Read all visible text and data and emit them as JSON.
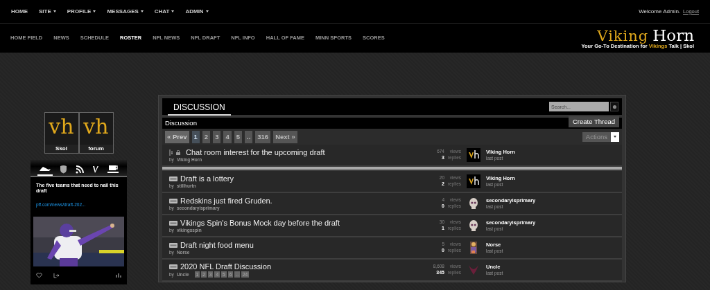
{
  "top_nav": [
    {
      "label": "HOME",
      "has_menu": false
    },
    {
      "label": "SITE",
      "has_menu": true
    },
    {
      "label": "PROFILE",
      "has_menu": true
    },
    {
      "label": "MESSAGES",
      "has_menu": true
    },
    {
      "label": "CHAT",
      "has_menu": true
    },
    {
      "label": "ADMIN",
      "has_menu": true
    }
  ],
  "welcome": "Welcome Admin.",
  "logout": "Logout",
  "main_nav": [
    {
      "label": "HOME FIELD",
      "selected": false
    },
    {
      "label": "NEWS",
      "selected": false
    },
    {
      "label": "SCHEDULE",
      "selected": false
    },
    {
      "label": "ROSTER",
      "selected": true
    },
    {
      "label": "NFL NEWS",
      "selected": false
    },
    {
      "label": "NFL DRAFT",
      "selected": false
    },
    {
      "label": "NFL INFO",
      "selected": false
    },
    {
      "label": "HALL OF FAME",
      "selected": false
    },
    {
      "label": "MINN SPORTS",
      "selected": false
    },
    {
      "label": "SCORES",
      "selected": false
    }
  ],
  "site_logo": {
    "word1": "Viking",
    "word2": "Horn",
    "tagline_before": "Your Go-To Destination for ",
    "tagline_highlight": "Vikings",
    "tagline_after": " Talk | Skol"
  },
  "sidebar": {
    "logo": {
      "tiles": [
        {
          "letters": "vh",
          "caption": "Skol"
        },
        {
          "letters": "vh",
          "caption": "forum"
        }
      ]
    },
    "widget_tabs": [
      {
        "kind": "ship",
        "selected": true
      },
      {
        "kind": "shield",
        "selected": false
      },
      {
        "kind": "rss",
        "selected": false
      },
      {
        "kind": "v",
        "selected": false
      },
      {
        "kind": "cup",
        "selected": false
      }
    ],
    "tweet": {
      "text": "The five teams that need to nail this draft",
      "link": "pff.com/news/draft-202..."
    }
  },
  "forum": {
    "heading": "DISCUSSION",
    "search": {
      "placeholder": "Search..."
    },
    "section_title": "Discussion",
    "create_button": "Create Thread",
    "actions_button": "Actions",
    "pagination": [
      {
        "label": "« Prev",
        "selected": false,
        "disabled": true
      },
      {
        "label": "1",
        "selected": true,
        "disabled": false
      },
      {
        "label": "2",
        "selected": false,
        "disabled": false
      },
      {
        "label": "3",
        "selected": false,
        "disabled": false
      },
      {
        "label": "4",
        "selected": false,
        "disabled": false
      },
      {
        "label": "5",
        "selected": false,
        "disabled": false
      },
      {
        "label": "..",
        "selected": false,
        "disabled": false
      },
      {
        "label": "316",
        "selected": false,
        "disabled": false
      },
      {
        "label": "Next »",
        "selected": false,
        "disabled": false
      }
    ],
    "threads": [
      {
        "kind": "sticky",
        "title": "Chat room interest for the upcoming draft",
        "by": "by",
        "author": "Viking Horn",
        "views": "674",
        "views_label": "views",
        "replies": "3",
        "replies_label": "replies",
        "avatar": {
          "kind": "vh"
        },
        "last_poster": "Viking Horn",
        "last_post_label": "last post"
      },
      {
        "kind": "new",
        "title": "Draft is a lottery",
        "by": "by",
        "author": "stillhurtn",
        "views": "20",
        "views_label": "views",
        "replies": "2",
        "replies_label": "replies",
        "avatar": {
          "kind": "vh"
        },
        "last_poster": "Viking Horn",
        "last_post_label": "last post"
      },
      {
        "kind": "new",
        "title": "Redskins just fired Gruden.",
        "by": "by",
        "author": "secondaryisprimary",
        "views": "4",
        "views_label": "views",
        "replies": "0",
        "replies_label": "replies",
        "avatar": {
          "kind": "skull"
        },
        "last_poster": "secondaryisprimary",
        "last_post_label": "last post"
      },
      {
        "kind": "new",
        "title": "Vikings Spin's Bonus Mock day before the draft",
        "by": "by",
        "author": "vikingsspin",
        "views": "30",
        "views_label": "views",
        "replies": "1",
        "replies_label": "replies",
        "avatar": {
          "kind": "skull"
        },
        "last_poster": "secondaryisprimary",
        "last_post_label": "last post"
      },
      {
        "kind": "new",
        "title": "Draft night food menu",
        "by": "by",
        "author": "Norse",
        "views": "5",
        "views_label": "views",
        "replies": "0",
        "replies_label": "replies",
        "avatar": {
          "kind": "figure"
        },
        "last_poster": "Norse",
        "last_post_label": "last post"
      },
      {
        "kind": "new",
        "title": "2020 NFL Draft Discussion",
        "by": "by",
        "author": "Uncle",
        "pages": [
          "1",
          "2",
          "3",
          "4",
          "5",
          "6",
          "..",
          "24"
        ],
        "views": "8,608",
        "views_label": "views",
        "replies": "345",
        "replies_label": "replies",
        "avatar": {
          "kind": "horns"
        },
        "last_poster": "Uncle",
        "last_post_label": "last post"
      }
    ]
  }
}
